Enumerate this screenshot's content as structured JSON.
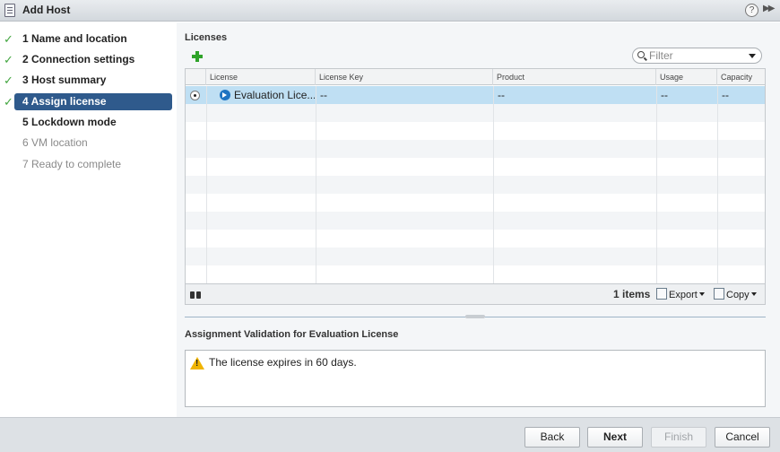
{
  "window": {
    "title": "Add Host"
  },
  "wizard": {
    "steps": [
      {
        "label": "1  Name and location"
      },
      {
        "label": "2  Connection settings"
      },
      {
        "label": "3  Host summary"
      },
      {
        "label": "4  Assign license"
      },
      {
        "label": "5  Lockdown mode"
      },
      {
        "label": "6  VM location"
      },
      {
        "label": "7  Ready to complete"
      }
    ]
  },
  "licenses": {
    "title": "Licenses",
    "filter_placeholder": "Filter",
    "columns": [
      "License",
      "License Key",
      "Product",
      "Usage",
      "Capacity"
    ],
    "rows": [
      {
        "license": "Evaluation Lice...",
        "key": "--",
        "product": "--",
        "usage": "--",
        "capacity": "--"
      }
    ],
    "footer": {
      "items": "1 items",
      "export": "Export",
      "copy": "Copy"
    }
  },
  "validation": {
    "title": "Assignment Validation for Evaluation License",
    "message": "The license expires in 60 days."
  },
  "buttons": {
    "back": "Back",
    "next": "Next",
    "finish": "Finish",
    "cancel": "Cancel"
  },
  "colors": {
    "accent": "#2f5a8c",
    "selected_row": "#bfdff3",
    "check": "#43a640",
    "warning": "#f0b400"
  }
}
